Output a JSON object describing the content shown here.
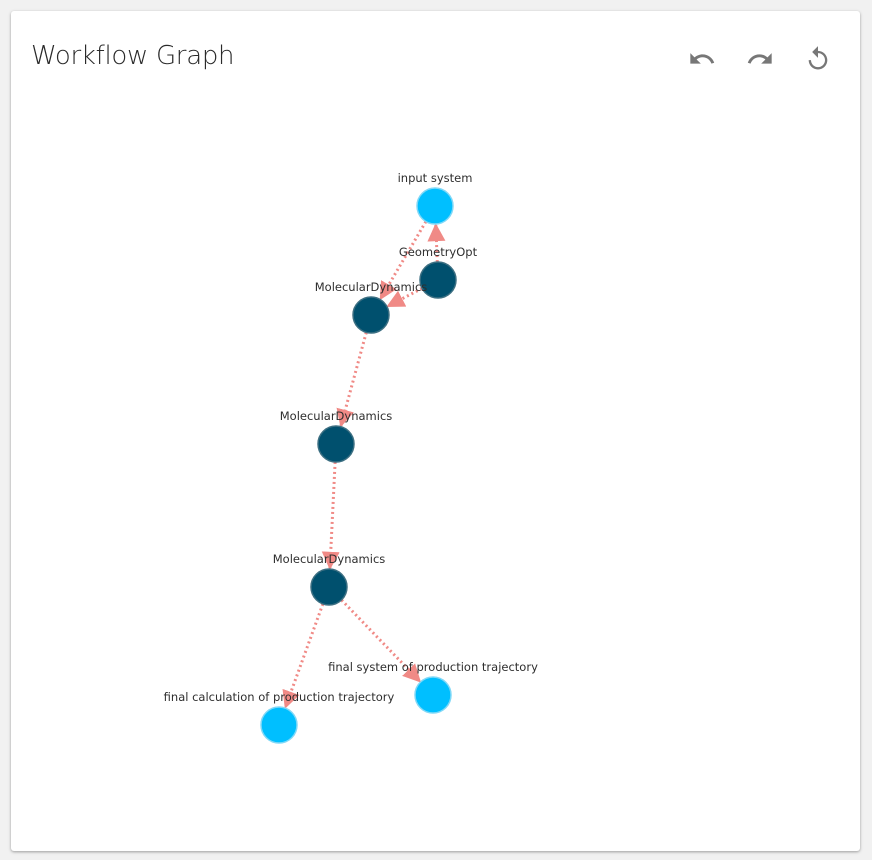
{
  "header": {
    "title": "Workflow Graph",
    "buttons": [
      {
        "name": "undo-button",
        "icon": "undo-icon"
      },
      {
        "name": "redo-button",
        "icon": "redo-icon"
      },
      {
        "name": "reset-button",
        "icon": "refresh-icon"
      }
    ]
  },
  "colors": {
    "input_node": "#00bfff",
    "process_node": "#00506e",
    "edge": "#f08a86",
    "icon": "#777777"
  },
  "graph": {
    "nodes": [
      {
        "id": "n0",
        "label": "input system",
        "kind": "input"
      },
      {
        "id": "n1",
        "label": "GeometryOpt",
        "kind": "process"
      },
      {
        "id": "n2",
        "label": "MolecularDynamics",
        "kind": "process"
      },
      {
        "id": "n3",
        "label": "MolecularDynamics",
        "kind": "process"
      },
      {
        "id": "n4",
        "label": "MolecularDynamics",
        "kind": "process"
      },
      {
        "id": "n5",
        "label": "final system of production trajectory",
        "kind": "input"
      },
      {
        "id": "n6",
        "label": "final calculation of production trajectory",
        "kind": "input"
      }
    ],
    "edges": [
      {
        "from": "n1",
        "to": "n0"
      },
      {
        "from": "n0",
        "to": "n2"
      },
      {
        "from": "n1",
        "to": "n2"
      },
      {
        "from": "n2",
        "to": "n3"
      },
      {
        "from": "n3",
        "to": "n4"
      },
      {
        "from": "n4",
        "to": "n5"
      },
      {
        "from": "n4",
        "to": "n6"
      }
    ]
  }
}
